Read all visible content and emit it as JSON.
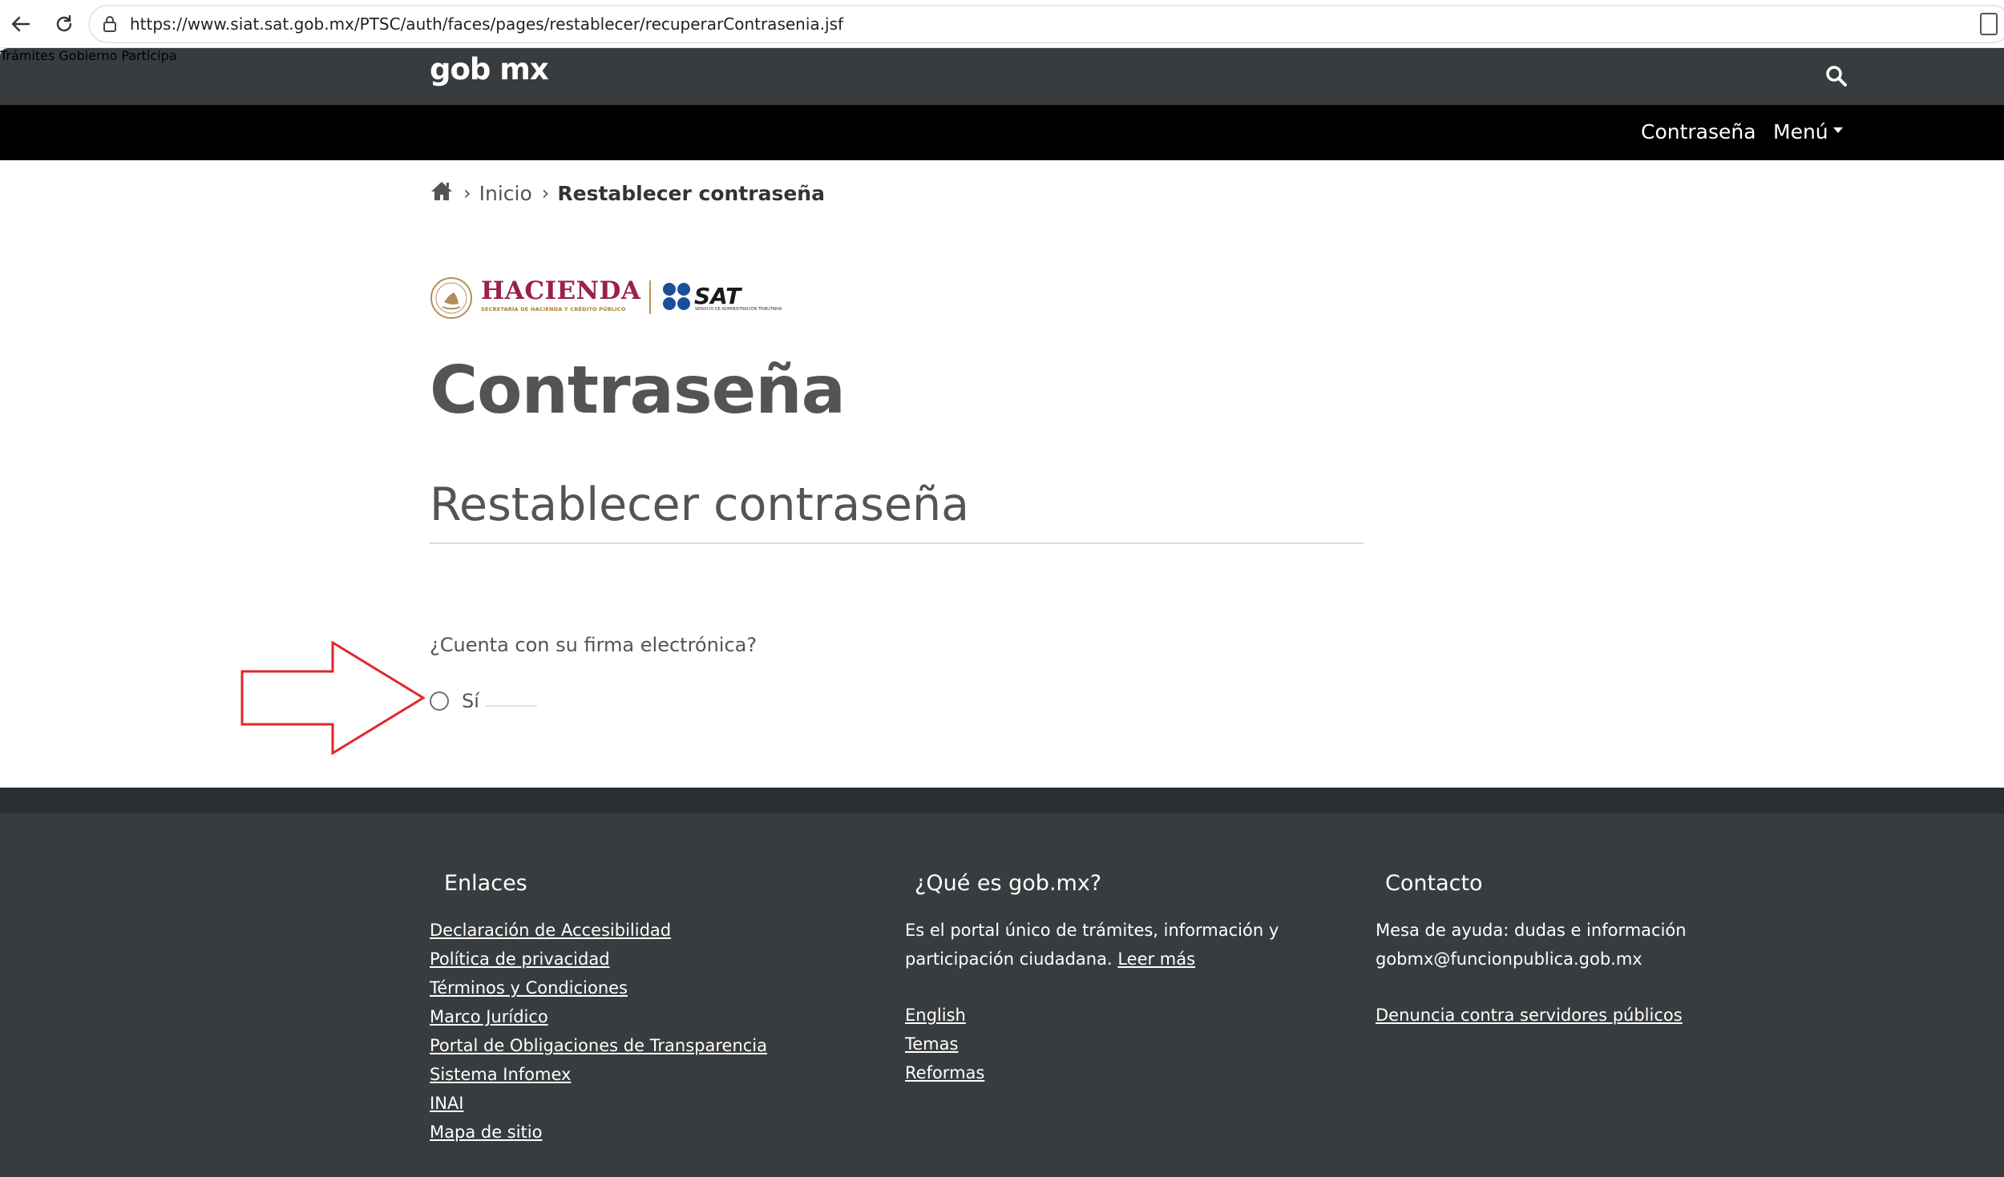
{
  "browser": {
    "url": "https://www.siat.sat.gob.mx/PTSC/auth/faces/pages/restablecer/recuperarContrasenia.jsf",
    "back_icon": "arrow-left-icon",
    "reload_icon": "reload-icon",
    "lock_icon": "lock-icon"
  },
  "header": {
    "logo": "gob mx",
    "nav": [
      "Trámites",
      "Gobierno",
      "Participa"
    ],
    "search_icon": "search-icon",
    "sub_nav": {
      "contrasena": "Contraseña",
      "menu": "Menú"
    }
  },
  "breadcrumb": {
    "home_icon": "home-icon",
    "inicio": "Inicio",
    "current": "Restablecer contraseña"
  },
  "logos": {
    "hacienda": "HACIENDA",
    "hacienda_sub": "SECRETARÍA DE HACIENDA Y CRÉDITO PÚBLICO",
    "sat": "SAT",
    "sat_sub": "SERVICIO DE ADMINISTRACIÓN TRIBUTARIA",
    "accent": "#9b2247"
  },
  "main": {
    "title": "Contraseña",
    "section_title": "Restablecer contraseña",
    "question": "¿Cuenta con su firma electrónica?",
    "option_yes": "Sí",
    "annotation_arrow_color": "#e3262c"
  },
  "footer": {
    "col1": {
      "title": "Enlaces",
      "links": [
        "Declaración de Accesibilidad",
        "Política de privacidad",
        "Términos y Condiciones",
        "Marco Jurídico",
        "Portal de Obligaciones de Transparencia",
        "Sistema Infomex",
        "INAI",
        "Mapa de sitio"
      ]
    },
    "col2": {
      "title": "¿Qué es gob.mx?",
      "text1": "Es el portal único de trámites, información y",
      "text2": "participación ciudadana.",
      "read_more": "Leer más",
      "links": [
        "English",
        "Temas",
        "Reformas"
      ]
    },
    "col3": {
      "title": "Contacto",
      "line1": "Mesa de ayuda: dudas e información",
      "line2": "gobmx@funcionpublica.gob.mx",
      "link": "Denuncia contra servidores públicos"
    }
  }
}
